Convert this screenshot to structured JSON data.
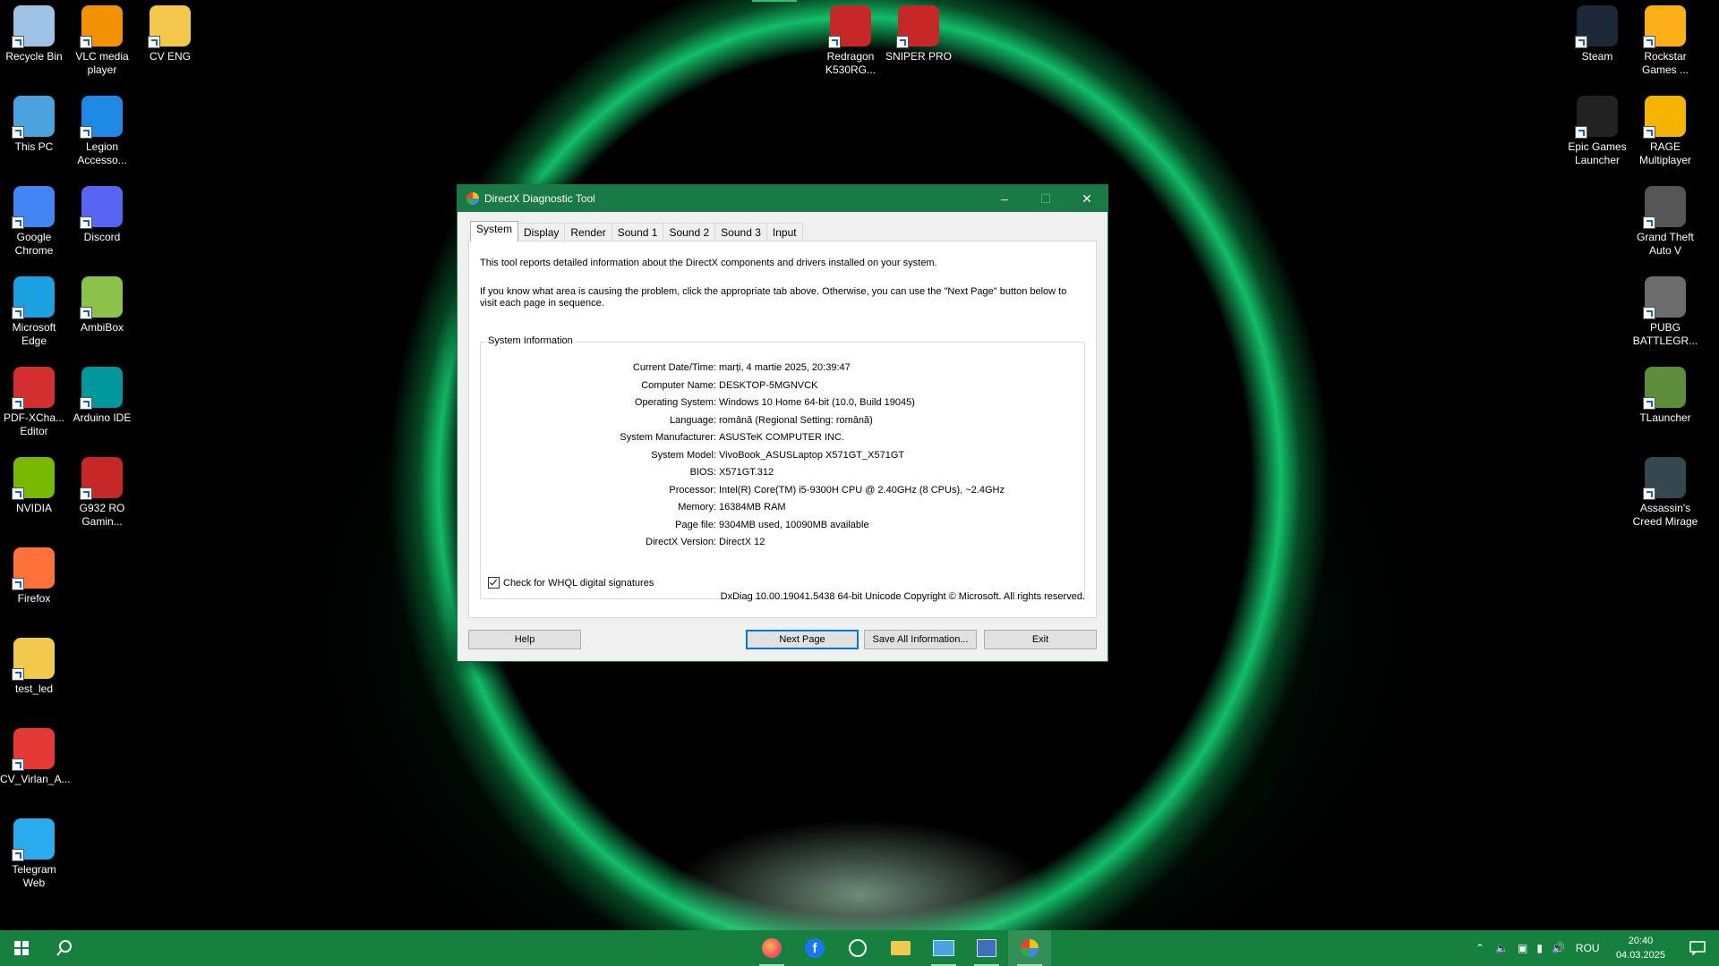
{
  "desktop_icons_left": [
    {
      "label": "Recycle Bin",
      "icon": "recycle-bin-icon",
      "color": "#9ec3e6"
    },
    {
      "label": "VLC media player",
      "icon": "vlc-icon",
      "color": "#f39200"
    },
    {
      "label": "CV ENG",
      "icon": "folder-icon",
      "color": "#f2c94c"
    },
    {
      "label": "This PC",
      "icon": "monitor-icon",
      "color": "#4aa3df"
    },
    {
      "label": "Legion Accesso...",
      "icon": "legion-icon",
      "color": "#1e88e5"
    },
    {
      "label": "Google Chrome",
      "icon": "chrome-icon",
      "color": "#4285f4"
    },
    {
      "label": "Discord",
      "icon": "discord-icon",
      "color": "#5865f2"
    },
    {
      "label": "Microsoft Edge",
      "icon": "edge-icon",
      "color": "#1ba1e2"
    },
    {
      "label": "AmbiBox",
      "icon": "cube-icon",
      "color": "#8bc34a"
    },
    {
      "label": "PDF-XCha... Editor",
      "icon": "pdf-icon",
      "color": "#d32f2f"
    },
    {
      "label": "Arduino IDE",
      "icon": "arduino-icon",
      "color": "#00979d"
    },
    {
      "label": "NVIDIA",
      "icon": "nvidia-icon",
      "color": "#76b900"
    },
    {
      "label": "G932 RO Gamin...",
      "icon": "redragon-icon",
      "color": "#c62828"
    },
    {
      "label": "Firefox",
      "icon": "firefox-icon",
      "color": "#ff7139"
    },
    {
      "label": "test_led",
      "icon": "folder-icon",
      "color": "#f2c94c"
    },
    {
      "label": "CV_Virlan_A...",
      "icon": "pdf-file-icon",
      "color": "#e53935"
    },
    {
      "label": "Telegram Web",
      "icon": "telegram-icon",
      "color": "#2aabee"
    }
  ],
  "desktop_icons_top": [
    {
      "label": "Redragon K530RG...",
      "icon": "redragon-icon",
      "color": "#c62828"
    },
    {
      "label": "SNIPER PRO",
      "icon": "redragon-icon",
      "color": "#c62828"
    }
  ],
  "desktop_icons_right": [
    {
      "label": "Steam",
      "icon": "steam-icon",
      "color": "#1b2838"
    },
    {
      "label": "Rockstar Games ...",
      "icon": "rockstar-icon",
      "color": "#fcaf17"
    },
    {
      "label": "Epic Games Launcher",
      "icon": "epic-icon",
      "color": "#222222"
    },
    {
      "label": "RAGE Multiplayer",
      "icon": "rage-icon",
      "color": "#f5b400"
    },
    {
      "label": "Grand Theft Auto V",
      "icon": "gta-icon",
      "color": "#555555"
    },
    {
      "label": "PUBG BATTLEGR...",
      "icon": "pubg-icon",
      "color": "#6d6d6d"
    },
    {
      "label": "TLauncher",
      "icon": "minecraft-icon",
      "color": "#5d8c3a"
    },
    {
      "label": "Assassin's Creed Mirage",
      "icon": "assassins-icon",
      "color": "#37474f"
    }
  ],
  "window": {
    "title": "DirectX Diagnostic Tool",
    "tabs": [
      "System",
      "Display",
      "Render",
      "Sound 1",
      "Sound 2",
      "Sound 3",
      "Input"
    ],
    "intro1": "This tool reports detailed information about the DirectX components and drivers installed on your system.",
    "intro2": "If you know what area is causing the problem, click the appropriate tab above.  Otherwise, you can use the \"Next Page\" button below to visit each page in sequence.",
    "group_title": "System Information",
    "info": [
      {
        "k": "Current Date/Time:",
        "v": "marți, 4 martie 2025, 20:39:47"
      },
      {
        "k": "Computer Name:",
        "v": "DESKTOP-5MGNVCK"
      },
      {
        "k": "Operating System:",
        "v": "Windows 10 Home 64-bit (10.0, Build 19045)"
      },
      {
        "k": "Language:",
        "v": "română (Regional Setting: română)"
      },
      {
        "k": "System Manufacturer:",
        "v": "ASUSTeK COMPUTER INC."
      },
      {
        "k": "System Model:",
        "v": "VivoBook_ASUSLaptop X571GT_X571GT"
      },
      {
        "k": "BIOS:",
        "v": "X571GT.312"
      },
      {
        "k": "Processor:",
        "v": "Intel(R) Core(TM) i5-9300H CPU @ 2.40GHz (8 CPUs), ~2.4GHz"
      },
      {
        "k": "Memory:",
        "v": "16384MB RAM"
      },
      {
        "k": "Page file:",
        "v": "9304MB used, 10090MB available"
      },
      {
        "k": "DirectX Version:",
        "v": "DirectX 12"
      }
    ],
    "whql_label": "Check for WHQL digital signatures",
    "copyright": "DxDiag 10.00.19041.5438 64-bit Unicode  Copyright © Microsoft. All rights reserved.",
    "buttons": {
      "help": "Help",
      "next": "Next Page",
      "save": "Save All Information...",
      "exit": "Exit"
    }
  },
  "taskbar": {
    "language": "ROU",
    "time": "20:40",
    "date": "04.03.2025"
  }
}
